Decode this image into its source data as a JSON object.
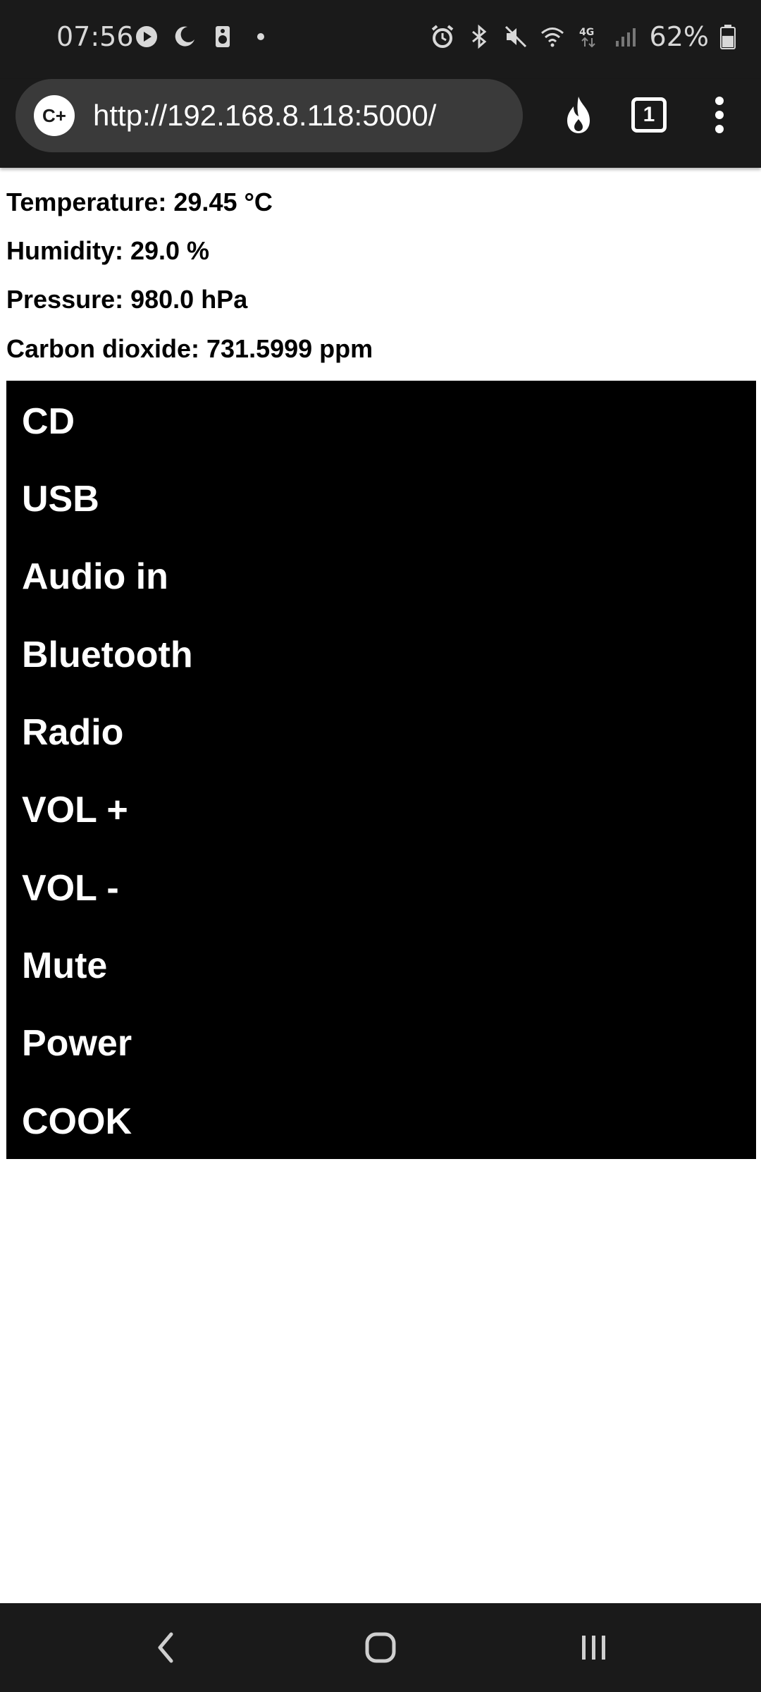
{
  "status_bar": {
    "time": "07:56",
    "battery_percent": "62%",
    "battery_level": 0.62,
    "left_icons": [
      "play-circle-icon",
      "moon-icon",
      "speaker-icon",
      "dot-icon"
    ],
    "right_icons": [
      "alarm-icon",
      "bluetooth-icon",
      "mute-icon",
      "wifi-icon",
      "4g-icon",
      "signal-icon",
      "battery-icon"
    ],
    "network_label": "4G"
  },
  "browser": {
    "site_icon_label": "C+",
    "url": "http://192.168.8.118:5000/",
    "tab_count": "1",
    "icons": [
      "flame-icon",
      "tabs-icon",
      "more-vert-icon"
    ]
  },
  "readings": {
    "temperature": "Temperature: 29.45 °C",
    "humidity": "Humidity: 29.0 %",
    "pressure": "Pressure: 980.0 hPa",
    "co2": "Carbon dioxide: 731.5999 ppm"
  },
  "buttons": [
    "CD",
    "USB",
    "Audio in",
    "Bluetooth",
    "Radio",
    "VOL +",
    "VOL -",
    "Mute",
    "Power",
    "COOK"
  ],
  "nav_bar": {
    "icons": [
      "back-icon",
      "home-icon",
      "recents-icon"
    ]
  },
  "colors": {
    "system_bar": "#1a1a1a",
    "url_pill": "#3a3a3a",
    "panel": "#000000",
    "page": "#ffffff"
  }
}
